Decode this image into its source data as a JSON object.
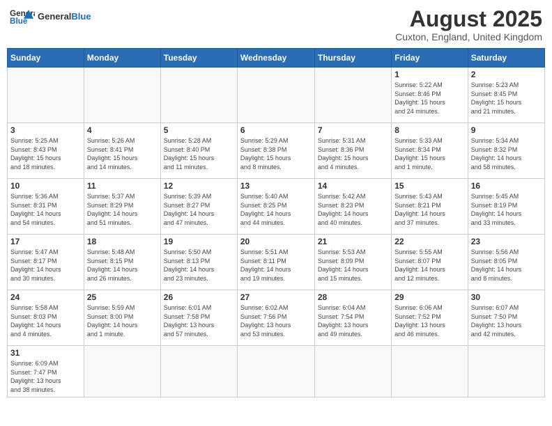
{
  "header": {
    "logo_general": "General",
    "logo_blue": "Blue",
    "title": "August 2025",
    "subtitle": "Cuxton, England, United Kingdom"
  },
  "weekdays": [
    "Sunday",
    "Monday",
    "Tuesday",
    "Wednesday",
    "Thursday",
    "Friday",
    "Saturday"
  ],
  "weeks": [
    [
      {
        "day": "",
        "info": ""
      },
      {
        "day": "",
        "info": ""
      },
      {
        "day": "",
        "info": ""
      },
      {
        "day": "",
        "info": ""
      },
      {
        "day": "",
        "info": ""
      },
      {
        "day": "1",
        "info": "Sunrise: 5:22 AM\nSunset: 8:46 PM\nDaylight: 15 hours\nand 24 minutes."
      },
      {
        "day": "2",
        "info": "Sunrise: 5:23 AM\nSunset: 8:45 PM\nDaylight: 15 hours\nand 21 minutes."
      }
    ],
    [
      {
        "day": "3",
        "info": "Sunrise: 5:25 AM\nSunset: 8:43 PM\nDaylight: 15 hours\nand 18 minutes."
      },
      {
        "day": "4",
        "info": "Sunrise: 5:26 AM\nSunset: 8:41 PM\nDaylight: 15 hours\nand 14 minutes."
      },
      {
        "day": "5",
        "info": "Sunrise: 5:28 AM\nSunset: 8:40 PM\nDaylight: 15 hours\nand 11 minutes."
      },
      {
        "day": "6",
        "info": "Sunrise: 5:29 AM\nSunset: 8:38 PM\nDaylight: 15 hours\nand 8 minutes."
      },
      {
        "day": "7",
        "info": "Sunrise: 5:31 AM\nSunset: 8:36 PM\nDaylight: 15 hours\nand 4 minutes."
      },
      {
        "day": "8",
        "info": "Sunrise: 5:33 AM\nSunset: 8:34 PM\nDaylight: 15 hours\nand 1 minute."
      },
      {
        "day": "9",
        "info": "Sunrise: 5:34 AM\nSunset: 8:32 PM\nDaylight: 14 hours\nand 58 minutes."
      }
    ],
    [
      {
        "day": "10",
        "info": "Sunrise: 5:36 AM\nSunset: 8:31 PM\nDaylight: 14 hours\nand 54 minutes."
      },
      {
        "day": "11",
        "info": "Sunrise: 5:37 AM\nSunset: 8:29 PM\nDaylight: 14 hours\nand 51 minutes."
      },
      {
        "day": "12",
        "info": "Sunrise: 5:39 AM\nSunset: 8:27 PM\nDaylight: 14 hours\nand 47 minutes."
      },
      {
        "day": "13",
        "info": "Sunrise: 5:40 AM\nSunset: 8:25 PM\nDaylight: 14 hours\nand 44 minutes."
      },
      {
        "day": "14",
        "info": "Sunrise: 5:42 AM\nSunset: 8:23 PM\nDaylight: 14 hours\nand 40 minutes."
      },
      {
        "day": "15",
        "info": "Sunrise: 5:43 AM\nSunset: 8:21 PM\nDaylight: 14 hours\nand 37 minutes."
      },
      {
        "day": "16",
        "info": "Sunrise: 5:45 AM\nSunset: 8:19 PM\nDaylight: 14 hours\nand 33 minutes."
      }
    ],
    [
      {
        "day": "17",
        "info": "Sunrise: 5:47 AM\nSunset: 8:17 PM\nDaylight: 14 hours\nand 30 minutes."
      },
      {
        "day": "18",
        "info": "Sunrise: 5:48 AM\nSunset: 8:15 PM\nDaylight: 14 hours\nand 26 minutes."
      },
      {
        "day": "19",
        "info": "Sunrise: 5:50 AM\nSunset: 8:13 PM\nDaylight: 14 hours\nand 23 minutes."
      },
      {
        "day": "20",
        "info": "Sunrise: 5:51 AM\nSunset: 8:11 PM\nDaylight: 14 hours\nand 19 minutes."
      },
      {
        "day": "21",
        "info": "Sunrise: 5:53 AM\nSunset: 8:09 PM\nDaylight: 14 hours\nand 15 minutes."
      },
      {
        "day": "22",
        "info": "Sunrise: 5:55 AM\nSunset: 8:07 PM\nDaylight: 14 hours\nand 12 minutes."
      },
      {
        "day": "23",
        "info": "Sunrise: 5:56 AM\nSunset: 8:05 PM\nDaylight: 14 hours\nand 8 minutes."
      }
    ],
    [
      {
        "day": "24",
        "info": "Sunrise: 5:58 AM\nSunset: 8:03 PM\nDaylight: 14 hours\nand 4 minutes."
      },
      {
        "day": "25",
        "info": "Sunrise: 5:59 AM\nSunset: 8:00 PM\nDaylight: 14 hours\nand 1 minute."
      },
      {
        "day": "26",
        "info": "Sunrise: 6:01 AM\nSunset: 7:58 PM\nDaylight: 13 hours\nand 57 minutes."
      },
      {
        "day": "27",
        "info": "Sunrise: 6:02 AM\nSunset: 7:56 PM\nDaylight: 13 hours\nand 53 minutes."
      },
      {
        "day": "28",
        "info": "Sunrise: 6:04 AM\nSunset: 7:54 PM\nDaylight: 13 hours\nand 49 minutes."
      },
      {
        "day": "29",
        "info": "Sunrise: 6:06 AM\nSunset: 7:52 PM\nDaylight: 13 hours\nand 46 minutes."
      },
      {
        "day": "30",
        "info": "Sunrise: 6:07 AM\nSunset: 7:50 PM\nDaylight: 13 hours\nand 42 minutes."
      }
    ],
    [
      {
        "day": "31",
        "info": "Sunrise: 6:09 AM\nSunset: 7:47 PM\nDaylight: 13 hours\nand 38 minutes."
      },
      {
        "day": "",
        "info": ""
      },
      {
        "day": "",
        "info": ""
      },
      {
        "day": "",
        "info": ""
      },
      {
        "day": "",
        "info": ""
      },
      {
        "day": "",
        "info": ""
      },
      {
        "day": "",
        "info": ""
      }
    ]
  ]
}
